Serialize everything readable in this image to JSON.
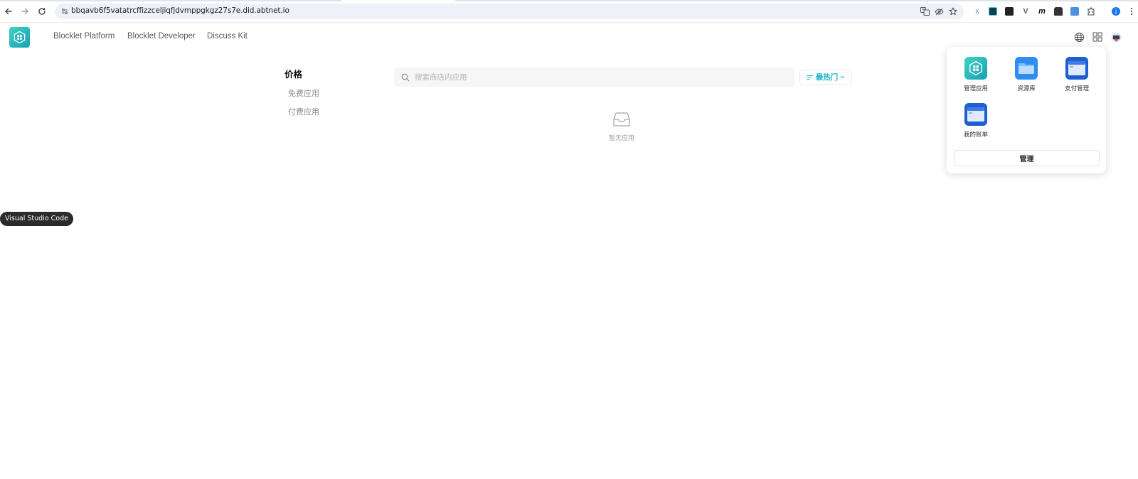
{
  "browser": {
    "url": "bbqavb6f5vatatrcffizzceljiqfjdvmppgkgz27s7e.did.abtnet.io",
    "icons": {
      "back": "arrow-left-icon",
      "forward": "arrow-right-icon",
      "reload": "reload-icon",
      "site_info": "site-info-icon",
      "translate": "translate-icon",
      "eye_off": "eye-off-icon",
      "bookmark": "star-icon",
      "extensions": "puzzle-icon",
      "profile": "profile-icon",
      "menu": "kebab-menu-icon"
    },
    "extension_letters": {
      "x": "x",
      "v": "V",
      "m": "m"
    },
    "profile_letter": "j"
  },
  "header": {
    "nav": [
      "Blocklet Platform",
      "Blocklet Developer",
      "Discuss Kit"
    ],
    "icons": {
      "language": "globe-icon",
      "apps": "grid-icon",
      "avatar": "avatar"
    }
  },
  "filters": {
    "title": "价格",
    "items": [
      "免费应用",
      "付费应用"
    ]
  },
  "search": {
    "placeholder": "搜索商店内应用"
  },
  "sort": {
    "label": "最热门"
  },
  "empty_state": {
    "text": "暂无应用"
  },
  "tooltip": {
    "text": "Visual Studio Code"
  },
  "apps_panel": {
    "tiles": [
      {
        "label": "管理应用"
      },
      {
        "label": "资源库"
      },
      {
        "label": "支付管理"
      },
      {
        "label": "我的账单"
      }
    ],
    "manage_label": "管理"
  },
  "colors": {
    "accent": "#1fb6c9",
    "teal_gradient_start": "#3ed3c5",
    "teal_gradient_end": "#1b9fb4",
    "folder_blue": "#2f8cf0",
    "app_window_blue": "#1d5fd1"
  }
}
